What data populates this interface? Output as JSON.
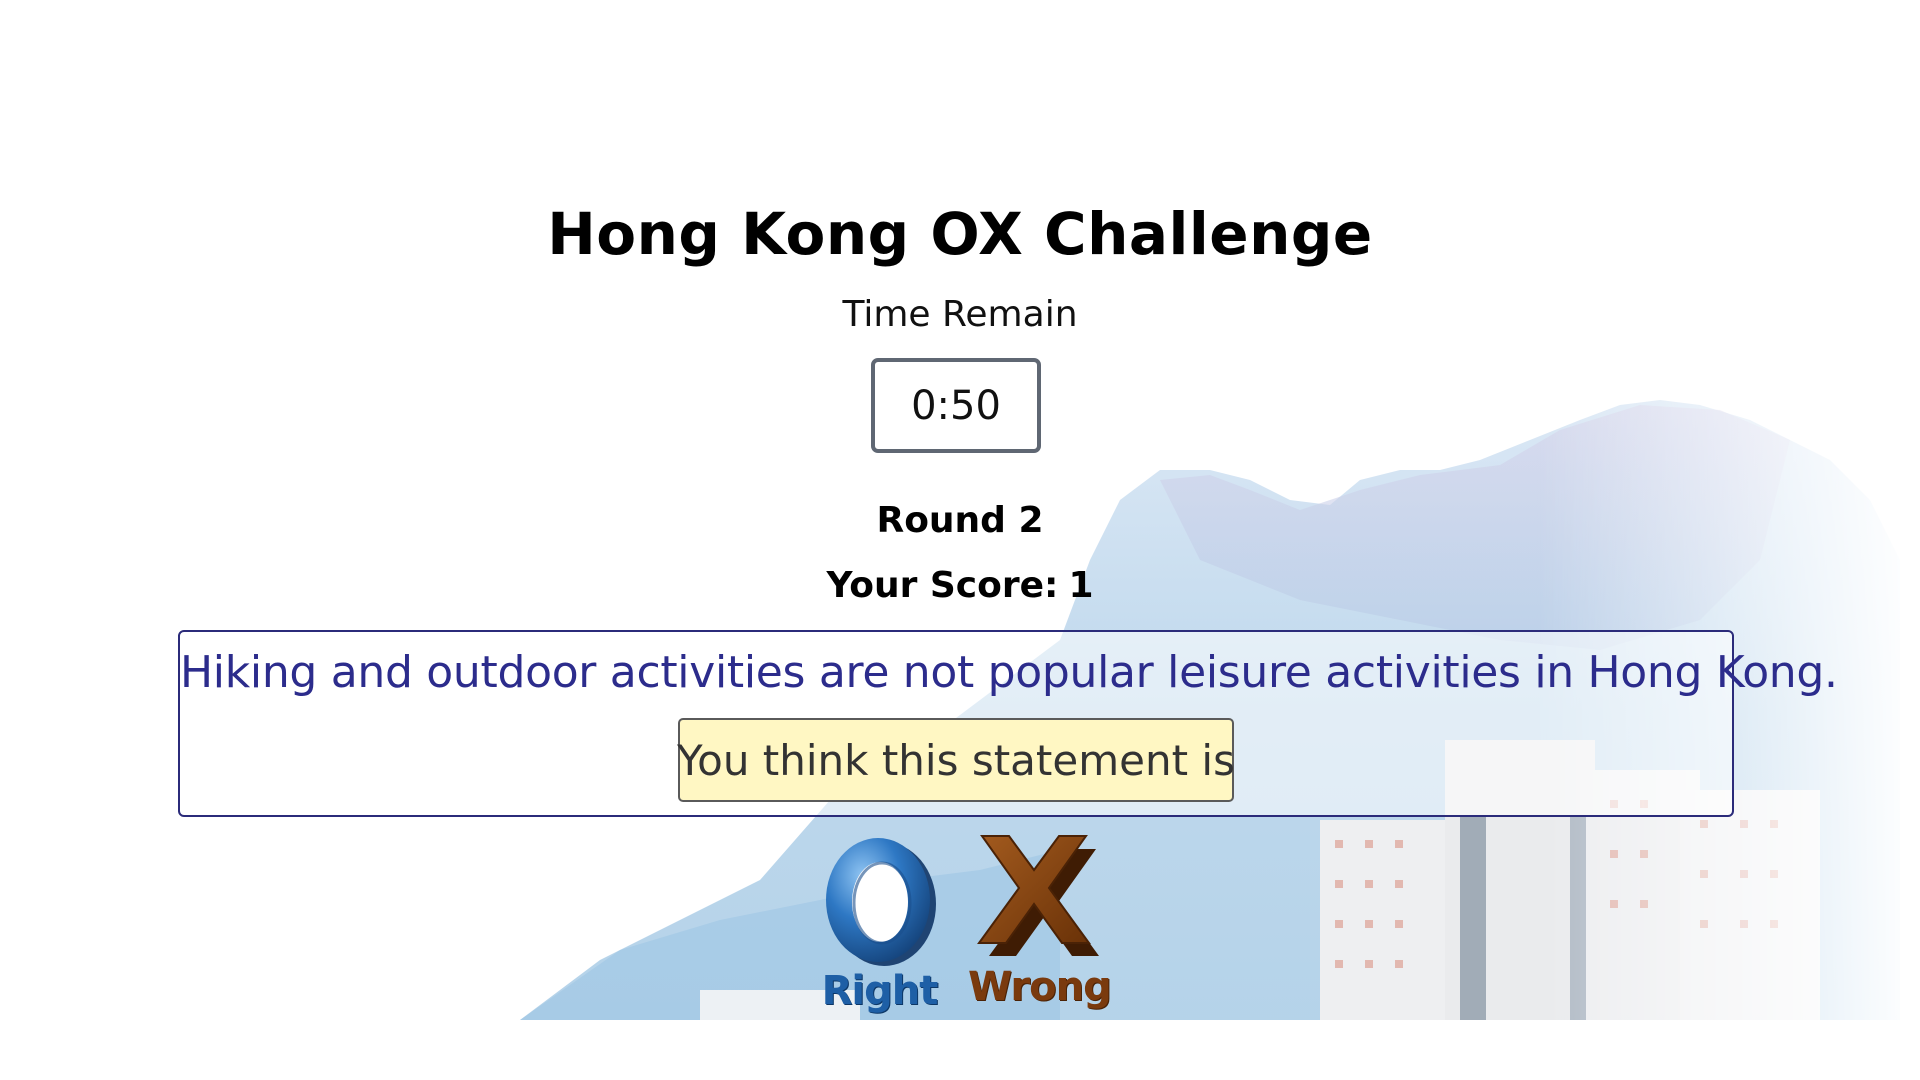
{
  "game": {
    "title": "Hong Kong OX Challenge",
    "time_label": "Time Remain",
    "timer_value": "0:50",
    "round_label": "Round 2",
    "score_label": "Your Score:",
    "score_value": "1"
  },
  "question": {
    "statement": "Hiking and outdoor activities are not popular leisure activities in Hong Kong.",
    "prompt": "You think this statement is"
  },
  "answers": {
    "right_label": "Right",
    "wrong_label": "Wrong",
    "right_icon": "o-ring-icon",
    "wrong_icon": "x-cross-icon"
  },
  "colors": {
    "question_text": "#2c2c8c",
    "prompt_bg": "#fff7c3",
    "right_blue": "#1e5fa6",
    "wrong_brown": "#7a3a0e"
  },
  "background": {
    "scene": "lion-rock-mountain-with-buildings"
  }
}
